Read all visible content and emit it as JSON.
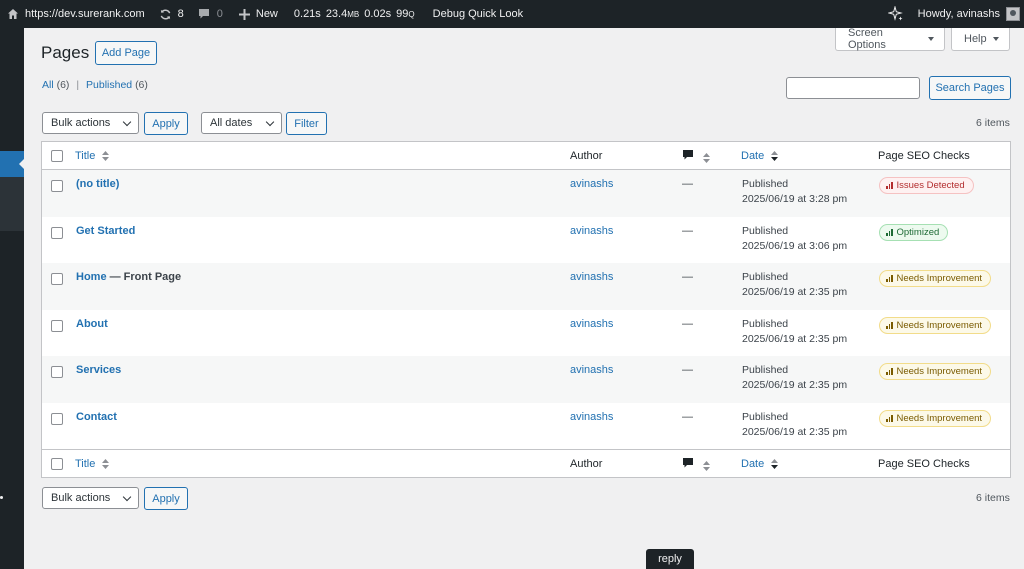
{
  "adminbar": {
    "site_url": "https://dev.surerank.com",
    "updates_count": "8",
    "comments_count": "0",
    "new_label": "New",
    "perf": {
      "time": "0.21s",
      "memory": "23.4",
      "memory_unit": "MB",
      "db_time": "0.02s",
      "queries": "99",
      "queries_unit": "Q"
    },
    "debug_label": "Debug Quick Look",
    "howdy": "Howdy, avinashs"
  },
  "screen_options_label": "Screen Options",
  "help_label": "Help",
  "page_title": "Pages",
  "add_page_label": "Add Page",
  "views": {
    "all_label": "All",
    "all_count": "(6)",
    "separator": "|",
    "published_label": "Published",
    "published_count": "(6)"
  },
  "search": {
    "button_label": "Search Pages",
    "value": ""
  },
  "top_nav": {
    "bulk_label": "Bulk actions",
    "apply_label": "Apply",
    "dates_label": "All dates",
    "filter_label": "Filter",
    "items_count": "6 items"
  },
  "bottom_nav": {
    "bulk_label": "Bulk actions",
    "apply_label": "Apply",
    "items_count": "6 items"
  },
  "columns": {
    "title": "Title",
    "author": "Author",
    "date": "Date",
    "seo": "Page SEO Checks"
  },
  "rows": [
    {
      "title": "(no title)",
      "suffix": "",
      "author": "avinashs",
      "comments": "—",
      "status": "Published",
      "date": "2025/06/19 at 3:28 pm",
      "seo": "Issues Detected",
      "seo_level": "issues"
    },
    {
      "title": "Get Started",
      "suffix": "",
      "author": "avinashs",
      "comments": "—",
      "status": "Published",
      "date": "2025/06/19 at 3:06 pm",
      "seo": "Optimized",
      "seo_level": "optimized"
    },
    {
      "title": "Home",
      "suffix": " — Front Page",
      "author": "avinashs",
      "comments": "—",
      "status": "Published",
      "date": "2025/06/19 at 2:35 pm",
      "seo": "Needs Improvement",
      "seo_level": "needs"
    },
    {
      "title": "About",
      "suffix": "",
      "author": "avinashs",
      "comments": "—",
      "status": "Published",
      "date": "2025/06/19 at 2:35 pm",
      "seo": "Needs Improvement",
      "seo_level": "needs"
    },
    {
      "title": "Services",
      "suffix": "",
      "author": "avinashs",
      "comments": "—",
      "status": "Published",
      "date": "2025/06/19 at 2:35 pm",
      "seo": "Needs Improvement",
      "seo_level": "needs"
    },
    {
      "title": "Contact",
      "suffix": "",
      "author": "avinashs",
      "comments": "—",
      "status": "Published",
      "date": "2025/06/19 at 2:35 pm",
      "seo": "Needs Improvement",
      "seo_level": "needs"
    }
  ],
  "tooltip": "reply",
  "colors": {
    "accent": "#2271b1",
    "adminbar": "#1d2327",
    "issues": "#b32d2e",
    "optimized": "#1e6b35",
    "needs": "#7a5b00"
  }
}
